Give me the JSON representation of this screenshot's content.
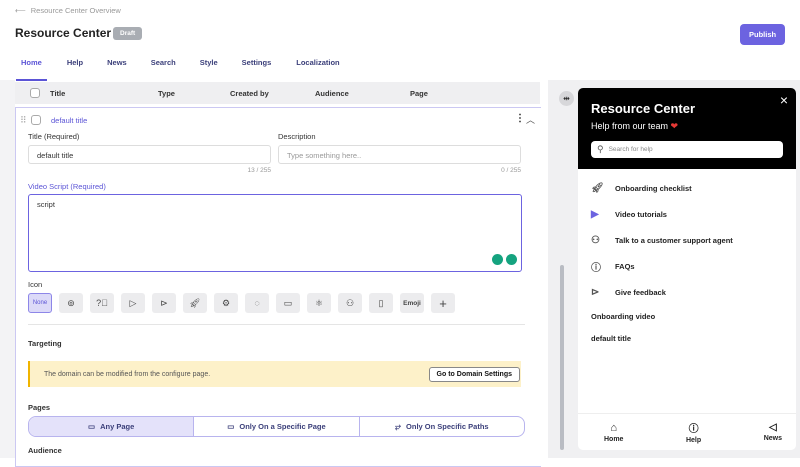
{
  "breadcrumb": "Resource Center Overview",
  "page_title": "Resource Center",
  "status_badge": "Draft",
  "publish_label": "Publish",
  "tabs": [
    "Home",
    "Help",
    "News",
    "Search",
    "Style",
    "Settings",
    "Localization"
  ],
  "table_headers": [
    "Title",
    "Type",
    "Created by",
    "Audience",
    "Page"
  ],
  "row": {
    "title": "default title",
    "title_label": "Title (Required)",
    "title_value": "default title",
    "title_count": "13 / 255",
    "description_label": "Description",
    "description_placeholder": "Type something here..",
    "description_count": "0 / 255",
    "script_label": "Video Script (Required)",
    "script_value": "script",
    "icon_label": "Icon",
    "icon_none": "None",
    "icon_emoji": "Emoji",
    "targeting_label": "Targeting",
    "warning_text": "The domain can be modified from the configure page.",
    "warning_button": "Go to Domain Settings",
    "pages_label": "Pages",
    "pages_options": [
      "Any Page",
      "Only On a Specific Page",
      "Only On Specific Paths"
    ],
    "audience_label": "Audience"
  },
  "preview": {
    "title": "Resource Center",
    "subtitle": "Help from our team",
    "search_placeholder": "Search for help",
    "items": [
      "Onboarding checklist",
      "Video tutorials",
      "Talk to a customer support agent",
      "FAQs",
      "Give feedback"
    ],
    "plain_items": [
      "Onboarding video",
      "default title"
    ],
    "nav": [
      "Home",
      "Help",
      "News"
    ]
  },
  "colors": {
    "accent": "#5b54d6",
    "publish": "#6c63e0",
    "warning_bg": "#fdf1c9"
  }
}
